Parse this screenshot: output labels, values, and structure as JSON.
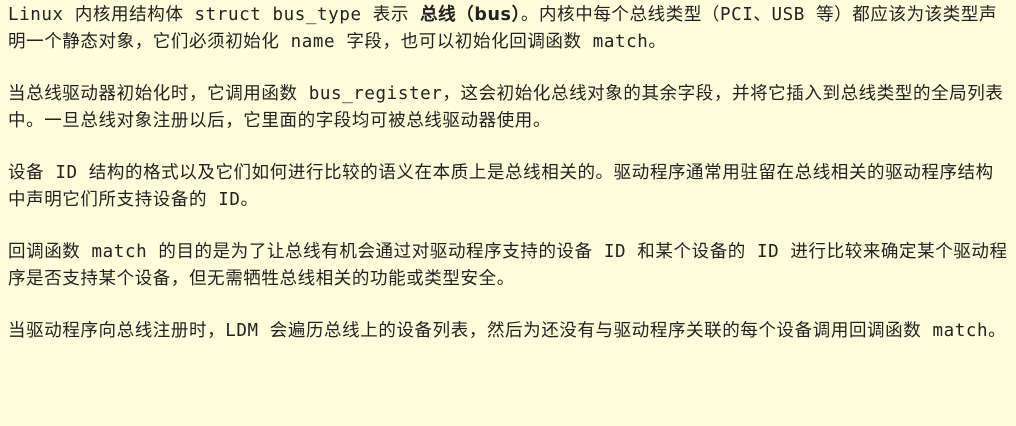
{
  "document": {
    "paragraphs": [
      {
        "pre": "Linux 内核用结构体 struct bus_type 表示 ",
        "bold": "总线（bus）",
        "post": "。内核中每个总线类型（PCI、USB 等）都应该为该类型声明一个静态对象，它们必须初始化 name 字段，也可以初始化回调函数 match。"
      },
      {
        "text": "当总线驱动器初始化时，它调用函数 bus_register，这会初始化总线对象的其余字段，并将它插入到总线类型的全局列表中。一旦总线对象注册以后，它里面的字段均可被总线驱动器使用。"
      },
      {
        "text": "设备 ID 结构的格式以及它们如何进行比较的语义在本质上是总线相关的。驱动程序通常用驻留在总线相关的驱动程序结构中声明它们所支持设备的 ID。"
      },
      {
        "text": "回调函数 match 的目的是为了让总线有机会通过对驱动程序支持的设备 ID 和某个设备的 ID 进行比较来确定某个驱动程序是否支持某个设备，但无需牺牲总线相关的功能或类型安全。"
      },
      {
        "text": "当驱动程序向总线注册时，LDM 会遍历总线上的设备列表，然后为还没有与驱动程序关联的每个设备调用回调函数 match。"
      }
    ]
  }
}
